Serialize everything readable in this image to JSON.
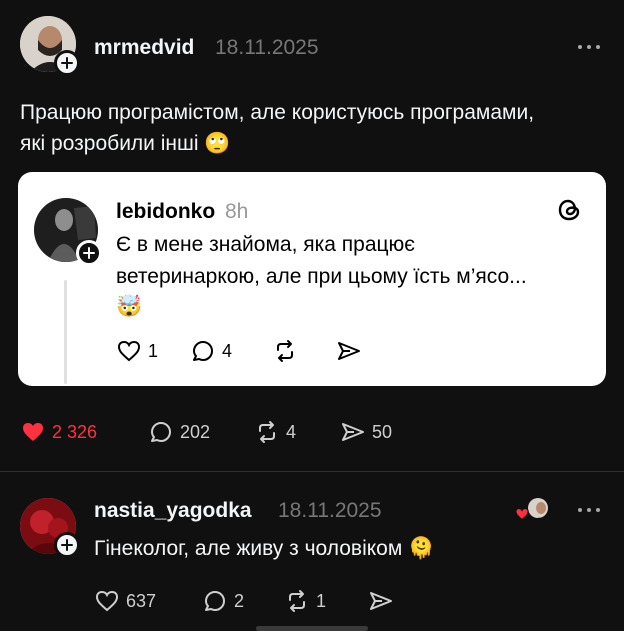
{
  "post": {
    "username": "mrmedvid",
    "date": "18.11.2025",
    "text_line1": "Працюю програмістом, але користуюсь програмами,",
    "text_line2": "які розробили інші 🙄",
    "likes": "2 326",
    "replies": "202",
    "reposts": "4",
    "shares": "50",
    "like_color": "#ff3040"
  },
  "quote": {
    "username": "lebidonko",
    "time": "8h",
    "text_line1": "Є в мене знайома, яка працює",
    "text_line2": "ветеринаркою, але при цьому їсть м’ясо...",
    "text_line3": "🤯",
    "likes": "1",
    "replies": "4"
  },
  "reply": {
    "username": "nastia_yagodka",
    "date": "18.11.2025",
    "text": "Гінеколог, але живу з чоловіком 🫠",
    "likes": "637",
    "replies": "2",
    "reposts": "1"
  }
}
